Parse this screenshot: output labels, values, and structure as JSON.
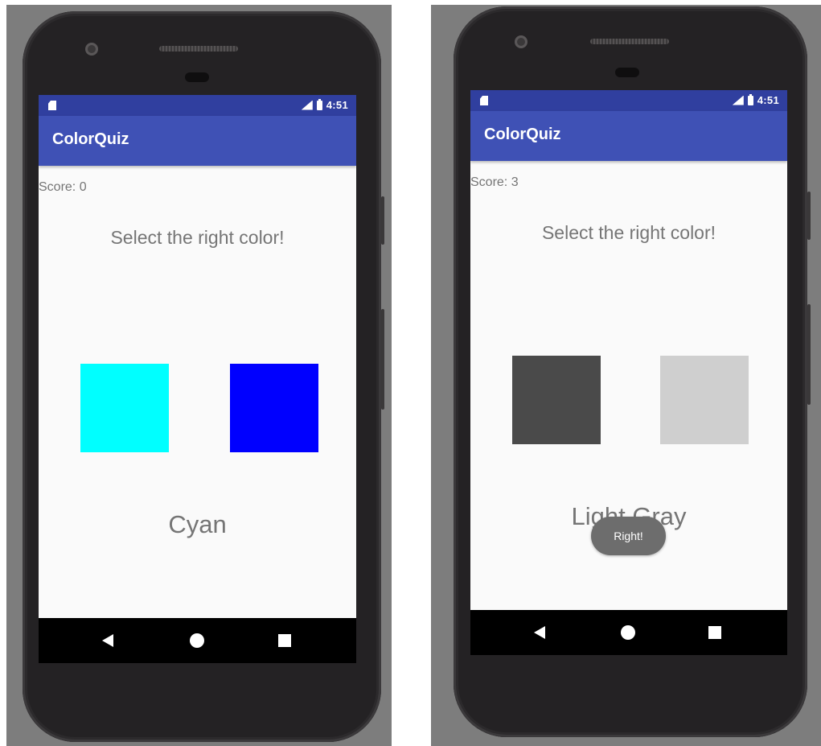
{
  "screens": [
    {
      "status_time": "4:51",
      "app_title": "ColorQuiz",
      "score_label": "Score: 0",
      "prompt": "Select the right color!",
      "swatches": [
        {
          "color": "#00ffff"
        },
        {
          "color": "#0000ff"
        }
      ],
      "answer": "Cyan",
      "toast": ""
    },
    {
      "status_time": "4:51",
      "app_title": "ColorQuiz",
      "score_label": "Score: 3",
      "prompt": "Select the right color!",
      "swatches": [
        {
          "color": "#4a4a4a"
        },
        {
          "color": "#cfcfcf"
        }
      ],
      "answer": "Light Gray",
      "toast": "Right!"
    }
  ],
  "theme": {
    "primary": "#3f51b5",
    "primary_dark": "#303f9f",
    "text_secondary": "#757575",
    "background": "#fafafa"
  }
}
